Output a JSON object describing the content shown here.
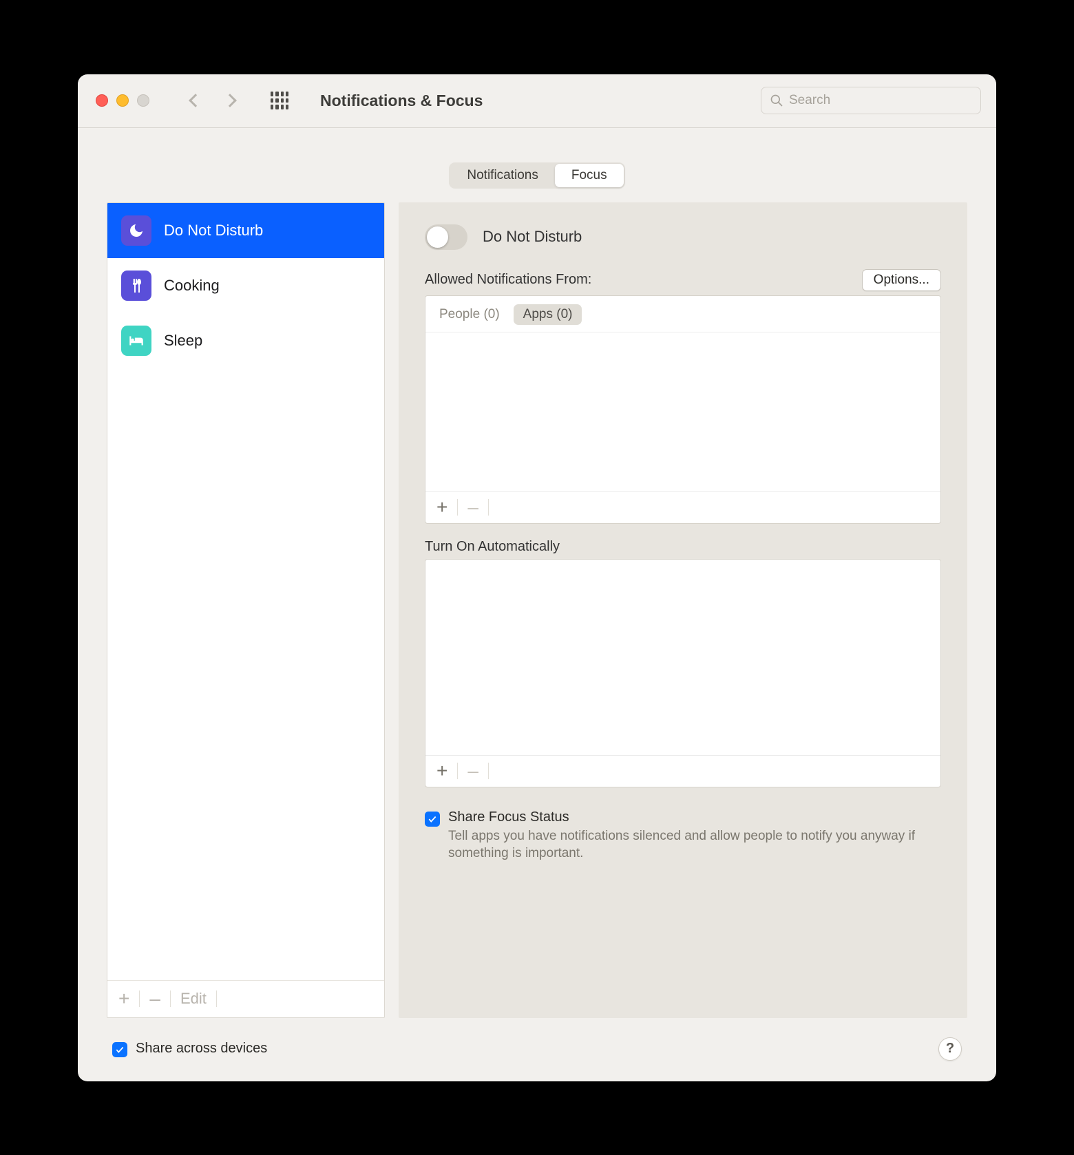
{
  "window": {
    "title": "Notifications & Focus"
  },
  "search": {
    "placeholder": "Search"
  },
  "tabs": {
    "notifications": "Notifications",
    "focus": "Focus",
    "active": "focus"
  },
  "sidebar": {
    "items": [
      {
        "label": "Do Not Disturb",
        "icon": "moon",
        "selected": true
      },
      {
        "label": "Cooking",
        "icon": "fork-knife",
        "selected": false
      },
      {
        "label": "Sleep",
        "icon": "bed",
        "selected": false
      }
    ],
    "footer": {
      "add": "+",
      "remove": "–",
      "edit": "Edit"
    }
  },
  "panel": {
    "toggle_label": "Do Not Disturb",
    "toggle_on": false,
    "allowed_heading": "Allowed Notifications From:",
    "options_button": "Options...",
    "allowed_tabs": {
      "people": "People (0)",
      "apps": "Apps (0)",
      "active": "apps"
    },
    "auto_heading": "Turn On Automatically",
    "share_focus": {
      "checked": true,
      "title": "Share Focus Status",
      "desc": "Tell apps you have notifications silenced and allow people to notify you anyway if something is important."
    }
  },
  "bottom": {
    "share_devices": {
      "checked": true,
      "label": "Share across devices"
    },
    "help": "?"
  }
}
